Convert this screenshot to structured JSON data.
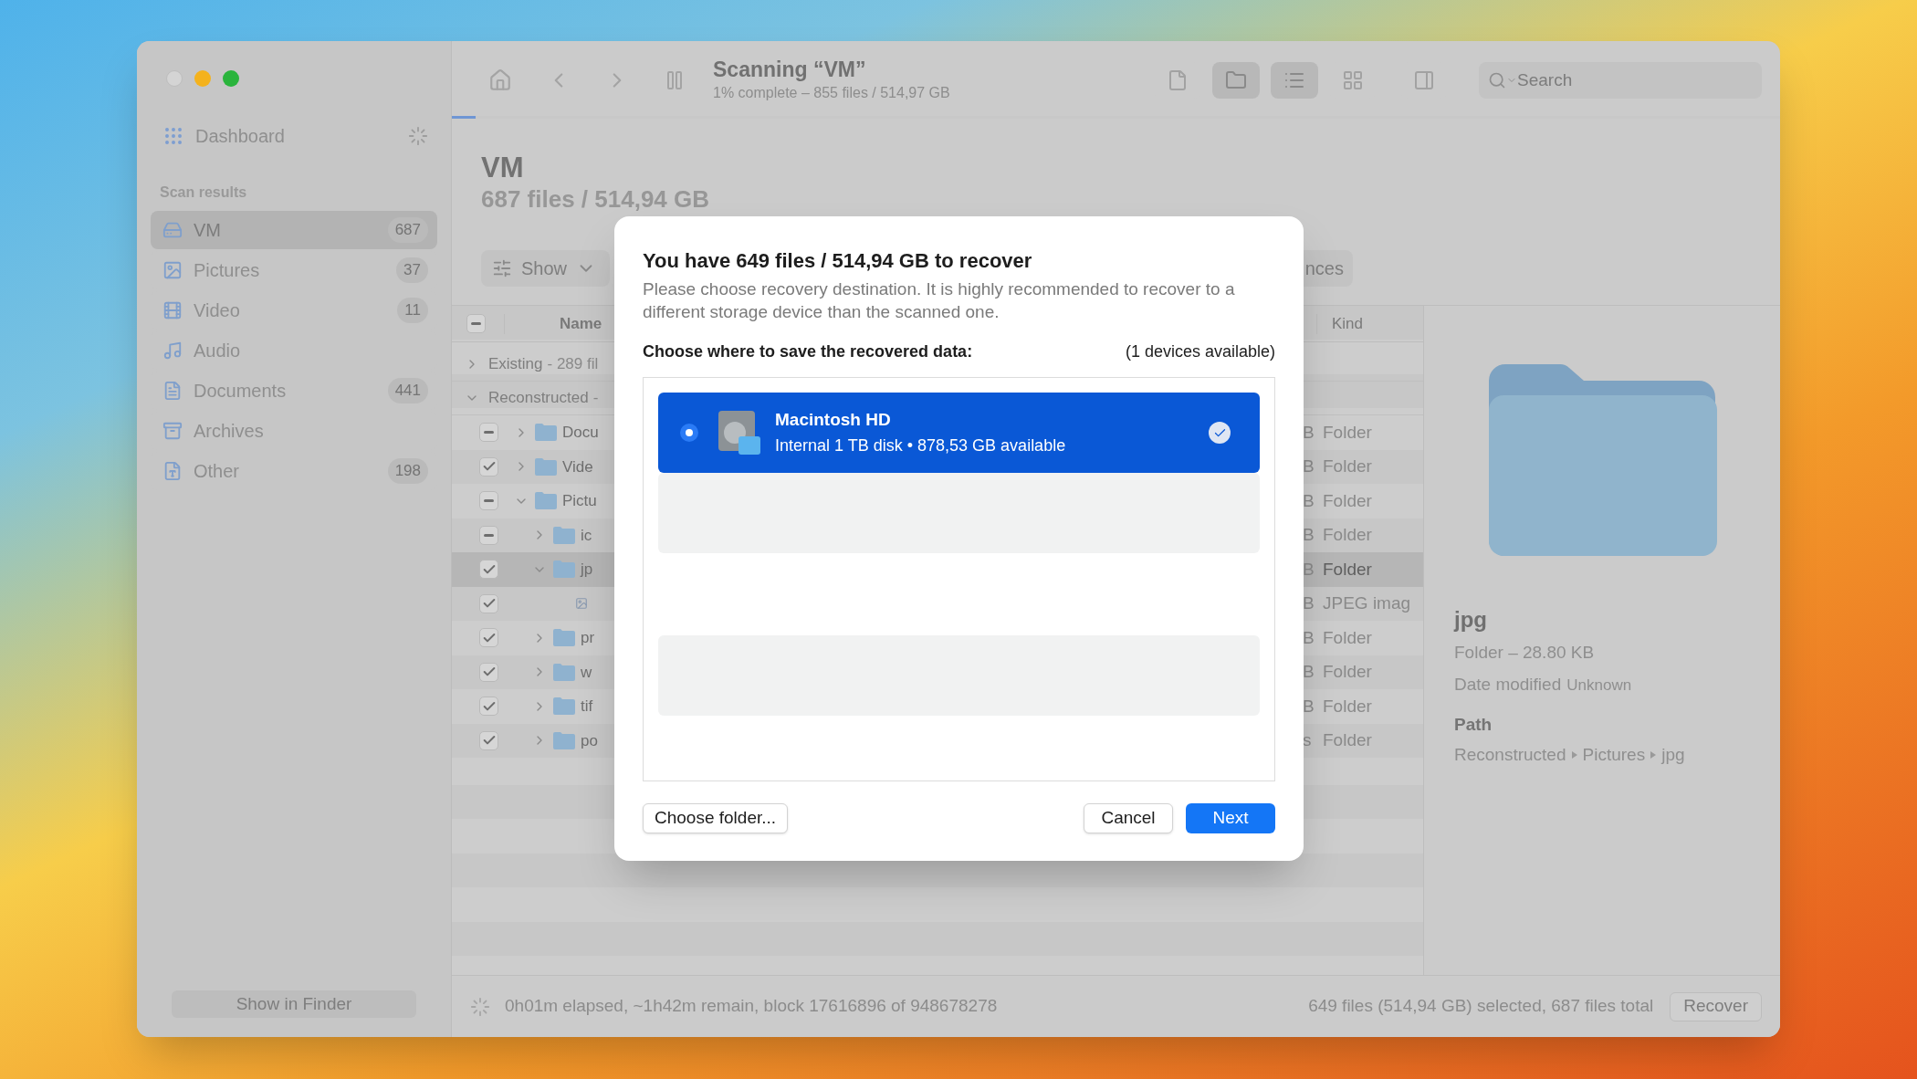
{
  "sidebar": {
    "dashboard": {
      "label": "Dashboard"
    },
    "section_title": "Scan results",
    "items": [
      {
        "label": "VM",
        "count": "687",
        "kind": "drive",
        "selected": true
      },
      {
        "label": "Pictures",
        "count": "37",
        "kind": "image",
        "selected": false
      },
      {
        "label": "Video",
        "count": "11",
        "kind": "film",
        "selected": false
      },
      {
        "label": "Audio",
        "kind": "music",
        "selected": false
      },
      {
        "label": "Documents",
        "count": "441",
        "kind": "document",
        "selected": false
      },
      {
        "label": "Archives",
        "kind": "archive",
        "selected": false
      },
      {
        "label": "Other",
        "count": "198",
        "kind": "other",
        "selected": false
      }
    ],
    "footer_button": "Show in Finder"
  },
  "toolbar": {
    "title": "Scanning “VM”",
    "subtitle": "1% complete – 855 files / 514,97 GB",
    "progress": {
      "level": 0.018
    },
    "view_buttons": [
      {
        "kind": "file",
        "selected": false
      },
      {
        "kind": "folder",
        "selected": true
      },
      {
        "kind": "list",
        "selected": true
      },
      {
        "kind": "grid",
        "selected": false
      },
      {
        "kind": "panel",
        "selected": false
      }
    ],
    "search": {
      "placeholder": "Search"
    }
  },
  "header": {
    "title": "VM",
    "subtitle": "687 files / 514,94 GB"
  },
  "filter_bar": {
    "show_button": "Show",
    "right_button": "nces"
  },
  "table": {
    "header_check": {
      "mixed": true
    },
    "columns": [
      {
        "label": "Name"
      },
      {
        "label": "Kind"
      }
    ],
    "groups": [
      {
        "label": "Existing",
        "detail": "- 289 fil",
        "expanded": false
      },
      {
        "label": "Reconstructed",
        "detail": "-",
        "expanded": true
      }
    ],
    "rows": [
      {
        "kind": "folder",
        "name": "Docu",
        "mixed": true,
        "expanded": false,
        "selected": false,
        "column_3": "B",
        "file_kind": "Folder"
      },
      {
        "kind": "folder",
        "name": "Vide",
        "checked": true,
        "expanded": false,
        "selected": false,
        "column_3": "B",
        "file_kind": "Folder"
      },
      {
        "kind": "folder",
        "name": "Pictu",
        "mixed": true,
        "expanded": true,
        "selected": false,
        "column_3": "B",
        "file_kind": "Folder",
        "children": [
          {
            "kind": "folder",
            "name": "ic",
            "mixed": true,
            "expanded": false,
            "selected": false,
            "column_3": "B",
            "file_kind": "Folder"
          },
          {
            "kind": "folder",
            "name": "jp",
            "checked": true,
            "expanded": true,
            "selected": true,
            "column_3": "B",
            "file_kind": "Folder",
            "children": [
              {
                "kind": "file",
                "checked": true,
                "selected": false,
                "column_3": "B",
                "file_kind": "JPEG imag"
              }
            ]
          },
          {
            "kind": "folder",
            "name": "pr",
            "checked": true,
            "expanded": false,
            "selected": false,
            "column_3": "B",
            "file_kind": "Folder"
          },
          {
            "kind": "folder",
            "name": "w",
            "checked": true,
            "expanded": false,
            "selected": false,
            "column_3": "B",
            "file_kind": "Folder"
          },
          {
            "kind": "folder",
            "name": "tif",
            "checked": true,
            "expanded": false,
            "selected": false,
            "column_3": "B",
            "file_kind": "Folder"
          },
          {
            "kind": "folder",
            "name": "po",
            "checked": true,
            "expanded": false,
            "selected": false,
            "column_3": "s",
            "file_kind": "Folder"
          }
        ]
      }
    ]
  },
  "preview": {
    "name": "jpg",
    "summary": "Folder – 28.80 KB",
    "date_label": "Date modified",
    "date_value": "Unknown",
    "path_label": "Path",
    "path": [
      "Reconstructed",
      "Pictures",
      "jpg"
    ]
  },
  "status_bar": {
    "progress_text": "0h01m elapsed, ~1h42m remain, block 17616896 of 948678278",
    "selection_text": "649 files (514,94 GB) selected, 687 files total",
    "button": "Recover"
  },
  "dialog": {
    "title": "You have 649 files / 514,94 GB to recover",
    "description": "Please choose recovery destination. It is highly recommended to recover to a different storage device than the scanned one.",
    "prompt": "Choose where to save the recovered data:",
    "device_count": "(1 devices available)",
    "devices": [
      {
        "name": "Macintosh HD",
        "detail": "Internal 1 TB disk • 878,53 GB available",
        "selected": true
      }
    ],
    "buttons": [
      {
        "label": "Choose folder...",
        "kind": "secondary"
      },
      {
        "label": "Cancel",
        "kind": "secondary"
      },
      {
        "label": "Next",
        "kind": "primary"
      }
    ]
  }
}
